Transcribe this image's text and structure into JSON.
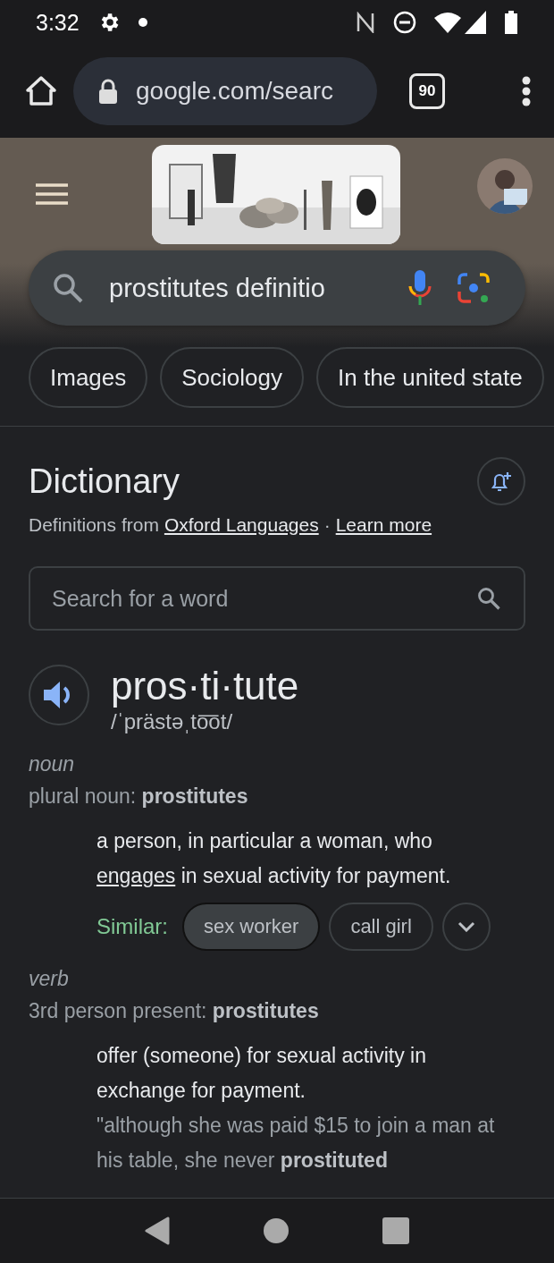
{
  "status_bar": {
    "time": "3:32"
  },
  "browser": {
    "url": "google.com/searc",
    "tab_count": "90"
  },
  "search": {
    "query": "prostitutes definitio"
  },
  "chips": [
    {
      "label": "Images"
    },
    {
      "label": "Sociology"
    },
    {
      "label": "In the united state"
    }
  ],
  "dictionary": {
    "title": "Dictionary",
    "source_prefix": "Definitions from",
    "source_link": "Oxford Languages",
    "separator": "·",
    "learn_more": "Learn more",
    "search_placeholder": "Search for a word",
    "word": "pros·ti·tute",
    "pronunciation": "/ˈprästəˌto͞ot/",
    "senses": [
      {
        "pos": "noun",
        "form": "plural noun: **prostitutes**",
        "definitions": [
          {
            "before": "a person, in particular a woman, who",
            "link": "engages",
            "after": "in sexual activity for payment.",
            "similar_label": "Similar:",
            "similar": [
              {
                "label": "sex worker",
                "selected": true
              },
              {
                "label": "call girl",
                "selected": false
              }
            ]
          }
        ]
      },
      {
        "pos": "verb",
        "form": "3rd person present: **prostitutes**",
        "definitions": [
          {
            "before": "offer (someone) for sexual activity in exchange for payment.",
            "example": "\"although she was paid $15 to join a man at his table, she never **prostituted**"
          }
        ]
      }
    ]
  }
}
